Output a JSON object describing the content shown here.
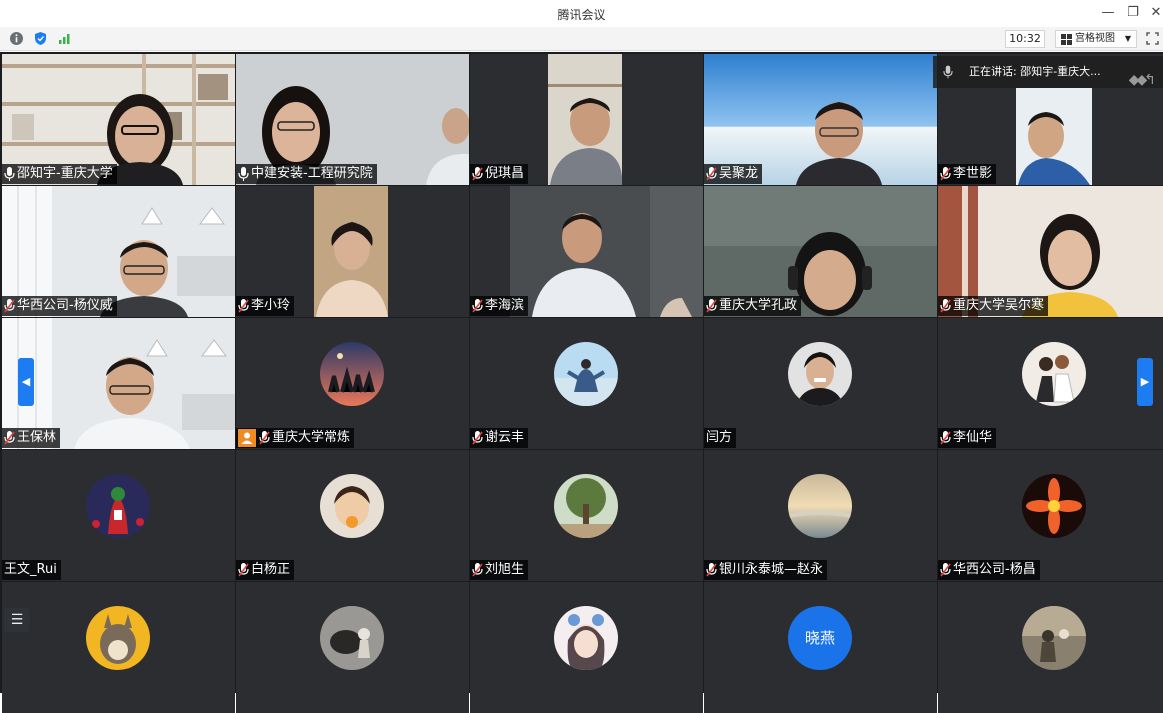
{
  "window": {
    "title": "腾讯会议"
  },
  "toolbar": {
    "time": "10:32",
    "view_mode": "宫格视图"
  },
  "speaking": {
    "label": "正在讲话: 邵知宇-重庆大..."
  },
  "colors": {
    "active_border": "#36b24a",
    "accent": "#1d7cf2",
    "host_badge": "#f08a24"
  },
  "tiles": [
    {
      "name": "邵知宇-重庆大学",
      "type": "video"
    },
    {
      "name": "中建安装-工程研究院",
      "type": "video"
    },
    {
      "name": "倪琪昌",
      "type": "video"
    },
    {
      "name": "吴聚龙",
      "type": "video"
    },
    {
      "name": "李世影",
      "type": "video"
    },
    {
      "name": "华西公司-杨仪威",
      "type": "video"
    },
    {
      "name": "李小玲",
      "type": "video"
    },
    {
      "name": "李海滨",
      "type": "video"
    },
    {
      "name": "重庆大学孔政",
      "type": "video"
    },
    {
      "name": "重庆大学吴尔寒",
      "type": "video"
    },
    {
      "name": "王保林",
      "type": "video"
    },
    {
      "name": "重庆大学常炼",
      "type": "avatar"
    },
    {
      "name": "谢云丰",
      "type": "avatar"
    },
    {
      "name": "闫方",
      "type": "avatar"
    },
    {
      "name": "李仙华",
      "type": "avatar"
    },
    {
      "name": "王文_Rui",
      "type": "avatar"
    },
    {
      "name": "白杨正",
      "type": "avatar"
    },
    {
      "name": "刘旭生",
      "type": "avatar"
    },
    {
      "name": "银川永泰城—赵永",
      "type": "avatar"
    },
    {
      "name": "华西公司-杨昌",
      "type": "avatar"
    },
    {
      "name": "",
      "type": "avatar"
    },
    {
      "name": "",
      "type": "avatar"
    },
    {
      "name": "",
      "type": "avatar"
    },
    {
      "name": "",
      "type": "avatar",
      "avatar_text": "晓燕"
    },
    {
      "name": "",
      "type": "avatar"
    }
  ]
}
